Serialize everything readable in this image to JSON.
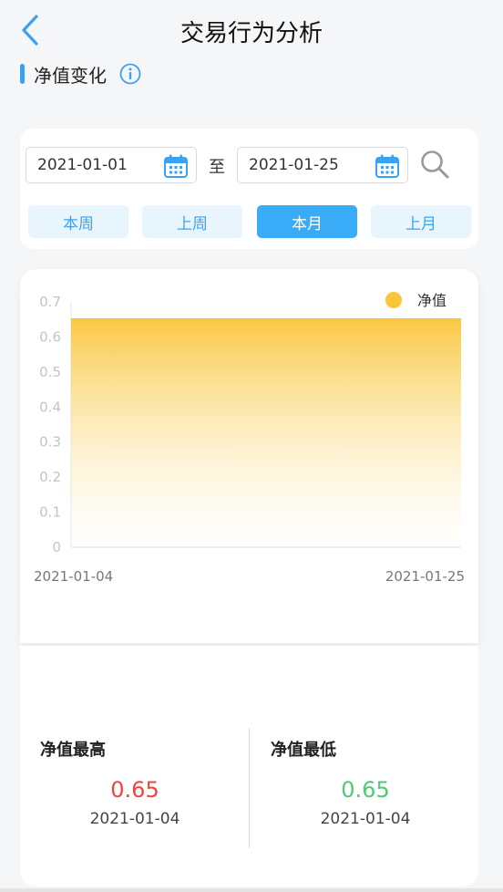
{
  "header": {
    "title": "交易行为分析"
  },
  "section": {
    "title": "净值变化"
  },
  "filter": {
    "start_date": "2021-01-01",
    "end_date": "2021-01-25",
    "to_label": "至",
    "quick_ranges": [
      "本周",
      "上周",
      "本月",
      "上月"
    ],
    "active_range": "本月"
  },
  "colors": {
    "accent": "#3aacf7",
    "series": "#f9c53b",
    "max_value": "#f0453e",
    "min_value": "#4ccb74"
  },
  "chart_data": {
    "type": "area",
    "x": [
      "2021-01-04",
      "2021-01-25"
    ],
    "series": [
      {
        "name": "净值",
        "values": [
          0.65,
          0.65
        ]
      }
    ],
    "ylim": [
      0,
      0.7
    ],
    "yticks": [
      "0",
      "0.1",
      "0.2",
      "0.3",
      "0.4",
      "0.5",
      "0.6",
      "0.7"
    ],
    "xtick_labels": [
      "2021-01-04",
      "2021-01-25"
    ],
    "legend_position": "top-right",
    "grid": false
  },
  "stats": {
    "max": {
      "label": "净值最高",
      "value": "0.65",
      "date": "2021-01-04"
    },
    "min": {
      "label": "净值最低",
      "value": "0.65",
      "date": "2021-01-04"
    }
  }
}
